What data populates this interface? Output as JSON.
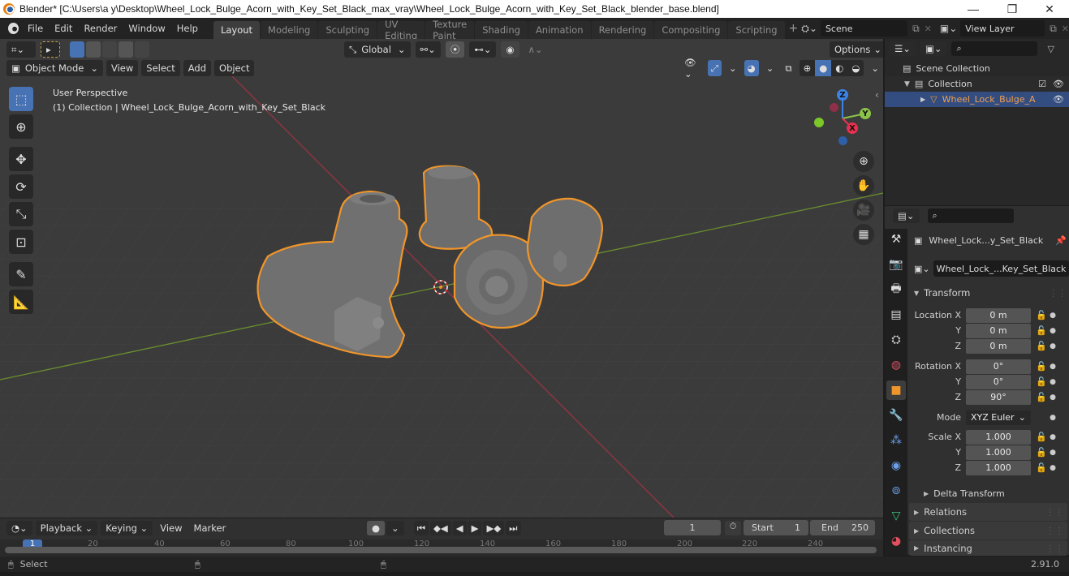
{
  "window": {
    "title": "Blender* [C:\\Users\\a y\\Desktop\\Wheel_Lock_Bulge_Acorn_with_Key_Set_Black_max_vray\\Wheel_Lock_Bulge_Acorn_with_Key_Set_Black_blender_base.blend]",
    "controls": {
      "minimize": "—",
      "maximize": "❐",
      "close": "✕"
    }
  },
  "menubar": {
    "items": [
      "File",
      "Edit",
      "Render",
      "Window",
      "Help"
    ],
    "workspaces": [
      "Layout",
      "Modeling",
      "Sculpting",
      "UV Editing",
      "Texture Paint",
      "Shading",
      "Animation",
      "Rendering",
      "Compositing",
      "Scripting"
    ],
    "active_workspace": "Layout",
    "add_workspace": "+",
    "scene": "Scene",
    "view_layer": "View Layer"
  },
  "viewport": {
    "header": {
      "mode": "Object Mode",
      "menus": [
        "View",
        "Select",
        "Add",
        "Object"
      ],
      "orientation": "Global",
      "options": "Options"
    },
    "overlay_text": {
      "perspective": "User Perspective",
      "collection": "(1) Collection | Wheel_Lock_Bulge_Acorn_with_Key_Set_Black"
    },
    "gizmo": {
      "z": "Z",
      "y": "Y",
      "x": "X"
    },
    "colors": {
      "selection_outline": "#f0952a",
      "x_axis": "#e8304f",
      "y_axis": "#8bc34a",
      "z_axis": "#3b83e6",
      "background": "#3b3b3b"
    }
  },
  "outliner": {
    "search_placeholder": "",
    "items": [
      {
        "label": "Scene Collection",
        "level": 0
      },
      {
        "label": "Collection",
        "level": 1
      },
      {
        "label": "Wheel_Lock_Bulge_A",
        "level": 2,
        "selected": true
      }
    ]
  },
  "properties": {
    "object_name": "Wheel_Lock...y_Set_Black",
    "data_name": "Wheel_Lock_...Key_Set_Black",
    "transform_label": "Transform",
    "location": {
      "label": "Location X",
      "x": "0 m",
      "y": "0 m",
      "z": "0 m"
    },
    "rotation": {
      "label": "Rotation X",
      "x": "0°",
      "y": "0°",
      "z": "90°"
    },
    "mode": {
      "label": "Mode",
      "value": "XYZ Euler"
    },
    "scale": {
      "label": "Scale X",
      "x": "1.000",
      "y": "1.000",
      "z": "1.000"
    },
    "axis_labels": {
      "y": "Y",
      "z": "Z"
    },
    "sections": [
      "Delta Transform",
      "Relations",
      "Collections",
      "Instancing"
    ]
  },
  "timeline": {
    "menus": [
      "Playback",
      "Keying",
      "View",
      "Marker"
    ],
    "current_frame": "1",
    "start_label": "Start",
    "start": "1",
    "end_label": "End",
    "end": "250",
    "ruler": [
      "1",
      "20",
      "40",
      "60",
      "80",
      "100",
      "120",
      "140",
      "160",
      "180",
      "200",
      "220",
      "240"
    ]
  },
  "statusbar": {
    "select": "Select",
    "version": "2.91.0"
  }
}
